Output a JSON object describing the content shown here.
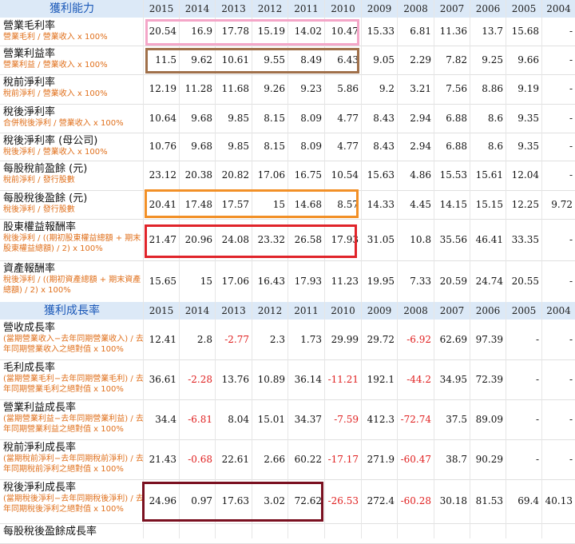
{
  "section1": {
    "title": "獲利能力",
    "years": [
      "2015",
      "2014",
      "2013",
      "2012",
      "2011",
      "2010",
      "2009",
      "2008",
      "2007",
      "2006",
      "2005",
      "2004"
    ],
    "rows": [
      {
        "label": "營業毛利率",
        "sub": "營業毛利 / 營業收入 x 100%",
        "values": [
          "20.54",
          "16.9",
          "17.78",
          "15.19",
          "14.02",
          "10.47",
          "15.33",
          "6.81",
          "11.36",
          "13.7",
          "15.68",
          "-"
        ]
      },
      {
        "label": "營業利益率",
        "sub": "營業利益 / 營業收入 x 100%",
        "values": [
          "11.5",
          "9.62",
          "10.61",
          "9.55",
          "8.49",
          "6.43",
          "9.05",
          "2.29",
          "7.82",
          "9.25",
          "9.66",
          "-"
        ]
      },
      {
        "label": "稅前淨利率",
        "sub": "稅前淨利 / 營業收入 x 100%",
        "values": [
          "12.19",
          "11.28",
          "11.68",
          "9.26",
          "9.23",
          "5.86",
          "9.2",
          "3.21",
          "7.56",
          "8.86",
          "9.19",
          "-"
        ]
      },
      {
        "label": "稅後淨利率",
        "sub": "合併稅後淨利 / 營業收入 x 100%",
        "values": [
          "10.64",
          "9.68",
          "9.85",
          "8.15",
          "8.09",
          "4.77",
          "8.43",
          "2.94",
          "6.88",
          "8.6",
          "9.35",
          "-"
        ]
      },
      {
        "label": "稅後淨利率 (母公司)",
        "sub": "稅後淨利 / 營業收入 x 100%",
        "values": [
          "10.76",
          "9.68",
          "9.85",
          "8.15",
          "8.09",
          "4.77",
          "8.43",
          "2.94",
          "6.88",
          "8.6",
          "9.35",
          "-"
        ]
      },
      {
        "label": "每股稅前盈餘 (元)",
        "sub": "稅前淨利 / 發行股數",
        "values": [
          "23.12",
          "20.38",
          "20.82",
          "17.06",
          "16.75",
          "10.54",
          "15.63",
          "4.86",
          "15.53",
          "15.61",
          "12.04",
          "-"
        ]
      },
      {
        "label": "每股稅後盈餘 (元)",
        "sub": "稅後淨利 / 發行股數",
        "values": [
          "20.41",
          "17.48",
          "17.57",
          "15",
          "14.68",
          "8.57",
          "14.33",
          "4.45",
          "14.15",
          "15.15",
          "12.25",
          "9.72"
        ]
      },
      {
        "label": "股東權益報酬率",
        "sub": "稅後淨利 / ((期初股東權益總額 + 期末股東權益總額) / 2) x 100%",
        "values": [
          "21.47",
          "20.96",
          "24.08",
          "23.32",
          "26.58",
          "17.93",
          "31.05",
          "10.8",
          "35.56",
          "46.41",
          "33.35",
          "-"
        ]
      },
      {
        "label": "資產報酬率",
        "sub": "稅後淨利 / ((期初資產總額 + 期末資產總額) / 2) x 100%",
        "values": [
          "15.65",
          "15",
          "17.06",
          "16.43",
          "17.93",
          "11.23",
          "19.95",
          "7.33",
          "20.59",
          "24.74",
          "20.55",
          "-"
        ]
      }
    ]
  },
  "section2": {
    "title": "獲利成長率",
    "years": [
      "2015",
      "2014",
      "2013",
      "2012",
      "2011",
      "2010",
      "2009",
      "2008",
      "2007",
      "2006",
      "2005",
      "2004"
    ],
    "rows": [
      {
        "label": "營收成長率",
        "sub": "(當期營業收入−去年同期營業收入) / 去年同期營業收入之絕對值 x 100%",
        "values": [
          "12.41",
          "2.8",
          "-2.77",
          "2.3",
          "1.73",
          "29.99",
          "29.72",
          "-6.92",
          "62.69",
          "97.39",
          "-",
          "-"
        ]
      },
      {
        "label": "毛利成長率",
        "sub": "(當期營業毛利−去年同期營業毛利) / 去年同期營業毛利之絕對值 x 100%",
        "values": [
          "36.61",
          "-2.28",
          "13.76",
          "10.89",
          "36.14",
          "-11.21",
          "192.1",
          "-44.2",
          "34.95",
          "72.39",
          "-",
          "-"
        ]
      },
      {
        "label": "營業利益成長率",
        "sub": "(當期營業利益−去年同期營業利益) / 去年同期營業利益之絕對值 x 100%",
        "values": [
          "34.4",
          "-6.81",
          "8.04",
          "15.01",
          "34.37",
          "-7.59",
          "412.3",
          "-72.74",
          "37.5",
          "89.09",
          "-",
          "-"
        ]
      },
      {
        "label": "稅前淨利成長率",
        "sub": "(當期稅前淨利−去年同期稅前淨利) / 去年同期稅前淨利之絕對值 x 100%",
        "values": [
          "21.43",
          "-0.68",
          "22.61",
          "2.66",
          "60.22",
          "-17.17",
          "271.9",
          "-60.47",
          "38.7",
          "90.29",
          "-",
          "-"
        ]
      },
      {
        "label": "稅後淨利成長率",
        "sub": "(當期稅後淨利−去年同期稅後淨利) / 去年同期稅後淨利之絕對值 x 100%",
        "values": [
          "24.96",
          "0.97",
          "17.63",
          "3.02",
          "72.62",
          "-26.53",
          "272.4",
          "-60.28",
          "30.18",
          "81.53",
          "69.4",
          "40.13"
        ]
      },
      {
        "label": "每股稅後盈餘成長率",
        "sub": "",
        "values": [
          "",
          "",
          "",
          "",
          "",
          "",
          "",
          "",
          "",
          "",
          "",
          ""
        ]
      }
    ]
  },
  "highlight_colors": {
    "pink": "#f4a6c8",
    "brown": "#a0704a",
    "orange": "#f29027",
    "red": "#e0242a",
    "dark_red": "#7a1020"
  }
}
